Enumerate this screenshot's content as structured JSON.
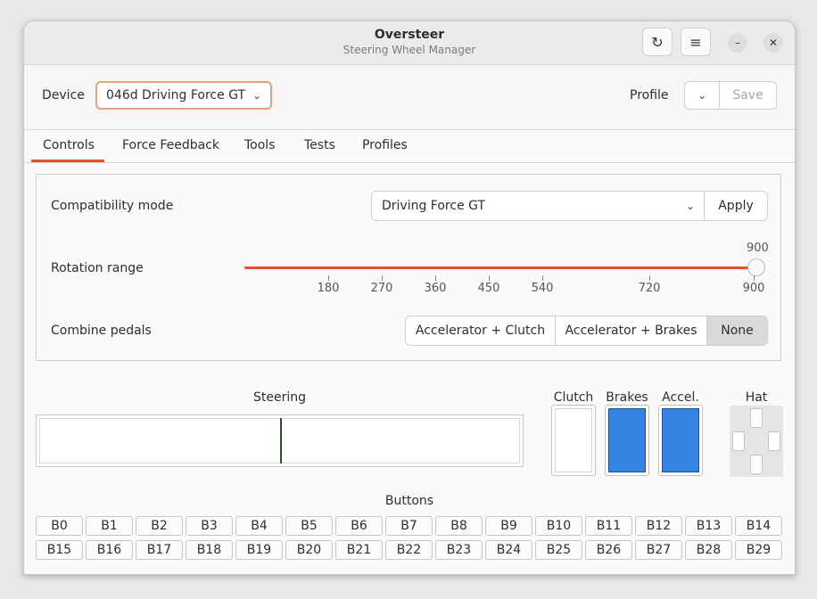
{
  "window": {
    "title": "Oversteer",
    "subtitle": "Steering Wheel Manager",
    "refresh_icon": "refresh-icon",
    "menu_icon": "hamburger-menu-icon",
    "minimize_icon": "minimize-icon",
    "close_icon": "close-icon"
  },
  "device_bar": {
    "device_label": "Device",
    "device_value": "046d Driving Force GT",
    "profile_label": "Profile",
    "save_label": "Save"
  },
  "tabs": [
    {
      "label": "Controls",
      "active": true
    },
    {
      "label": "Force Feedback",
      "active": false
    },
    {
      "label": "Tools",
      "active": false
    },
    {
      "label": "Tests",
      "active": false
    },
    {
      "label": "Profiles",
      "active": false
    }
  ],
  "controls": {
    "compat_label": "Compatibility mode",
    "compat_value": "Driving Force GT",
    "apply_label": "Apply",
    "rotation_label": "Rotation range",
    "rotation_value": "900",
    "rotation_ticks": [
      "180",
      "270",
      "360",
      "450",
      "540",
      "720",
      "900"
    ],
    "combine_label": "Combine pedals",
    "combine_options": [
      "Accelerator + Clutch",
      "Accelerator + Brakes",
      "None"
    ],
    "combine_selected": "None"
  },
  "inputs": {
    "steering_label": "Steering",
    "clutch_label": "Clutch",
    "brakes_label": "Brakes",
    "accel_label": "Accel.",
    "hat_label": "Hat",
    "buttons_label": "Buttons",
    "clutch_level": 0,
    "brakes_level": 1,
    "accel_level": 1,
    "steering_position": 0.5,
    "pedal_fill_color": "#3584e4"
  },
  "buttons_row1": [
    "B0",
    "B1",
    "B2",
    "B3",
    "B4",
    "B5",
    "B6",
    "B7",
    "B8",
    "B9",
    "B10",
    "B11",
    "B12",
    "B13",
    "B14"
  ],
  "buttons_row2": [
    "B15",
    "B16",
    "B17",
    "B18",
    "B19",
    "B20",
    "B21",
    "B22",
    "B23",
    "B24",
    "B25",
    "B26",
    "B27",
    "B28",
    "B29"
  ]
}
